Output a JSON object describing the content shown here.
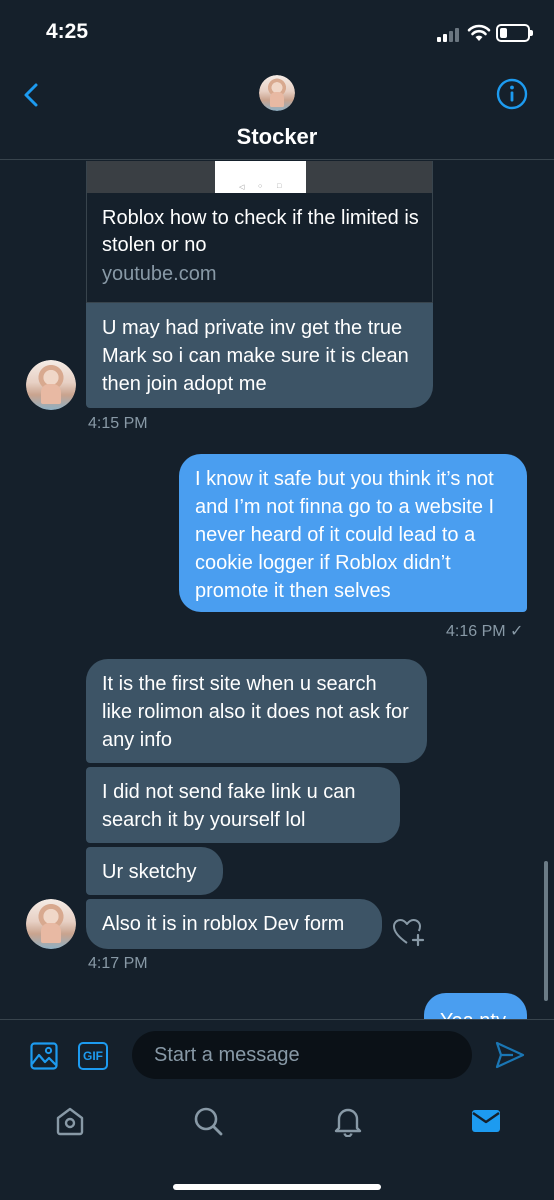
{
  "status_bar": {
    "time": "4:25",
    "icons": [
      "signal-icon",
      "wifi-icon",
      "battery-icon"
    ]
  },
  "header": {
    "contact_name": "Stocker",
    "icons": [
      "back-icon",
      "info-icon"
    ]
  },
  "link_card": {
    "title": "Roblox how to check if the limited is stolen or no",
    "domain": "youtube.com"
  },
  "messages": [
    {
      "direction": "in",
      "text": "U may had private inv get the true Mark so i can make sure it is clean then join adopt me"
    },
    {
      "direction": "out",
      "text": "I know it safe but you think it’s not and I’m not finna go to a website I never heard of it could lead to a cookie logger if Roblox didn’t promote it then selves"
    },
    {
      "direction": "in",
      "text": "It is the first site when u search like rolimon also it does not ask for any info"
    },
    {
      "direction": "in",
      "text": "I did not send fake link u can search it by yourself lol"
    },
    {
      "direction": "in",
      "text": "Ur sketchy"
    },
    {
      "direction": "in",
      "text": "Also it is in roblox Dev form"
    },
    {
      "direction": "out",
      "text": "Yea nty"
    }
  ],
  "timestamps": {
    "first": "4:15 PM",
    "second": "4:16 PM ✓",
    "third": "4:17 PM"
  },
  "composer": {
    "placeholder": "Start a message",
    "gif_label": "GIF"
  },
  "tab_bar": {
    "tabs": [
      "home-icon",
      "search-icon",
      "notifications-icon",
      "messages-icon"
    ],
    "active_tab": "messages-icon"
  },
  "colors": {
    "background": "#15202b",
    "incoming_bubble": "#3d5466",
    "outgoing_bubble": "#4a9ef0",
    "accent": "#1d9bf0",
    "muted_text": "#8899a6"
  }
}
